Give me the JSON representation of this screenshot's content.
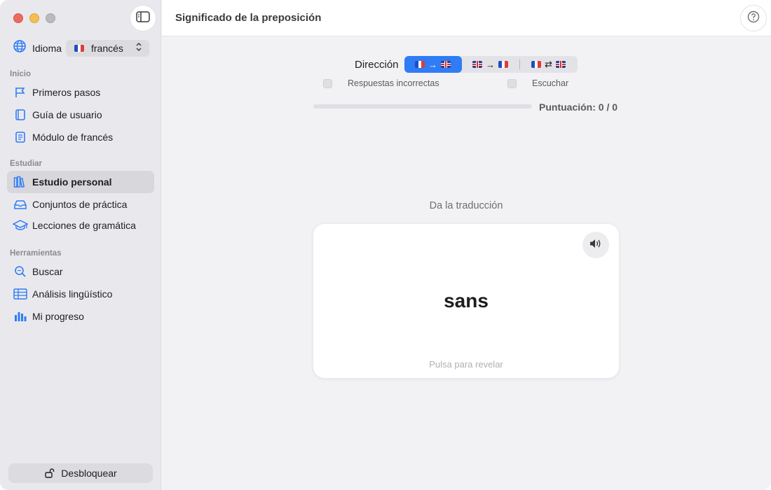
{
  "window": {
    "controls": [
      "close",
      "minimize",
      "zoom"
    ]
  },
  "sidebar": {
    "language_label": "Idioma",
    "language_value": "francés",
    "sections": [
      {
        "title": "Inicio",
        "items": [
          {
            "label": "Primeros pasos",
            "icon": "flag-icon"
          },
          {
            "label": "Guía de usuario",
            "icon": "book-icon"
          },
          {
            "label": "Módulo de francés",
            "icon": "module-book-icon"
          }
        ]
      },
      {
        "title": "Estudiar",
        "items": [
          {
            "label": "Estudio personal",
            "icon": "books-icon",
            "active": true
          },
          {
            "label": "Conjuntos de práctica",
            "icon": "tray-icon"
          },
          {
            "label": "Lecciones de gramática",
            "icon": "graduation-cap-icon"
          }
        ]
      },
      {
        "title": "Herramientas",
        "items": [
          {
            "label": "Buscar",
            "icon": "search-icon"
          },
          {
            "label": "Análisis lingüístico",
            "icon": "table-icon"
          },
          {
            "label": "Mi progreso",
            "icon": "bar-chart-icon"
          }
        ]
      }
    ],
    "unlock_label": "Desbloquear"
  },
  "header": {
    "title": "Significado de la preposición"
  },
  "main": {
    "direction_label": "Dirección",
    "direction_options": [
      {
        "from": "fr",
        "arrow": "→",
        "to": "gb",
        "selected": true
      },
      {
        "from": "gb",
        "arrow": "→",
        "to": "fr",
        "selected": false
      },
      {
        "from": "fr",
        "arrow": "⇄",
        "to": "gb",
        "selected": false
      }
    ],
    "option_incorrect": "Respuestas incorrectas",
    "option_listen": "Escuchar",
    "score_text": "Puntuación: 0 / 0",
    "progress": 0,
    "prompt": "Da la traducción",
    "card_word": "sans",
    "card_hint": "Pulsa para revelar"
  },
  "colors": {
    "accent": "#2f7cf6",
    "sidebar_bg": "#e9e9ed",
    "main_bg": "#f2f2f5"
  }
}
